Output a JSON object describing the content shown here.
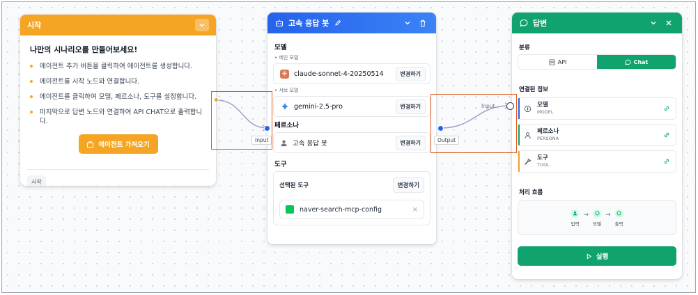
{
  "start_node": {
    "header": "시작",
    "title": "나만의 시나리오를 만들어보세요!",
    "bullets": [
      "에이전트 추가 버튼을 클릭하여 에이전트를 생성합니다.",
      "에이전트를 시작 노드와 연결합니다.",
      "에이전트를 클릭하여 모델, 페르소나, 도구를 설정합니다.",
      "마지막으로 답변 노드와 연결하여 API CHAT으로 출력합니다."
    ],
    "fetch_button": "에이전트 가져오기",
    "footer_tag": "시작",
    "accent": "#f5a524"
  },
  "agent_node": {
    "header": "고속 응답 봇",
    "model_section": "모델",
    "main_model_label": "• 메인 모델",
    "main_model": "claude-sonnet-4-20250514",
    "sub_model_label": "• 서브 모델",
    "sub_model": "gemini-2.5-pro",
    "persona_section": "페르소나",
    "persona": "고속 응답 봇",
    "tools_section": "도구",
    "selected_tools": "선택된 도구",
    "tool": "naver-search-mcp-config",
    "change_label": "변경하기",
    "remove_glyph": "×",
    "accent": "#2563eb"
  },
  "answer_node": {
    "header": "답변",
    "category_label": "분류",
    "tabs": [
      "API",
      "Chat"
    ],
    "active_tab": "Chat",
    "connected_label": "연결된 정보",
    "connections": [
      {
        "title": "모델",
        "subtitle": "MODEL",
        "color": "#2563eb"
      },
      {
        "title": "페르소나",
        "subtitle": "PERSONA",
        "color": "#10a36e"
      },
      {
        "title": "도구",
        "subtitle": "TOOL",
        "color": "#f5a524"
      }
    ],
    "flow_label": "처리 흐름",
    "flow_steps": [
      "입력",
      "모델",
      "출력"
    ],
    "run_button": "실행",
    "accent": "#10a36e"
  },
  "edges": {
    "input_label": "Input",
    "output_label": "Output",
    "answer_input_label": "Input"
  }
}
